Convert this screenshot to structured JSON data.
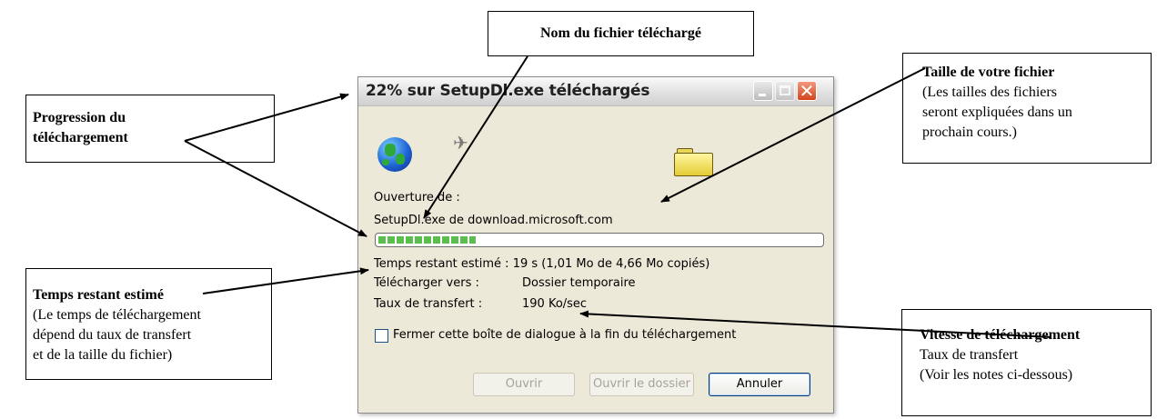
{
  "dialog": {
    "title": "22% sur SetupDl.exe téléchargés",
    "opening_label": "Ouverture de :",
    "source": "SetupDl.exe de download.microsoft.com",
    "progress": 0.22,
    "time_remaining": "Temps restant estimé : 19 s (1,01 Mo de 4,66 Mo copiés)",
    "download_to_label": "Télécharger vers :",
    "download_to_value": "Dossier temporaire",
    "rate_label": "Taux de transfert :",
    "rate_value": "190 Ko/sec",
    "checkbox_label": "Fermer cette boîte de dialogue à la fin du téléchargement",
    "checkbox_checked": false,
    "buttons": {
      "open": "Ouvrir",
      "open_folder": "Ouvrir le dossier",
      "cancel": "Annuler"
    },
    "window_buttons": {
      "close": "✕"
    },
    "icons": [
      "globe-icon",
      "paper-icon",
      "folder-icon"
    ]
  },
  "callouts": {
    "file_name": {
      "title": "Nom du fichier téléchargé"
    },
    "progress": {
      "title": "Progression du téléchargement"
    },
    "file_size": {
      "title": "Taille de votre fichier",
      "text": "(Les tailles des fichiers\nseront expliquées dans un\nprochain cours.)"
    },
    "time": {
      "title": "Temps restant estimé",
      "text": "(Le temps de téléchargement\ndépend du taux de transfert\net de la taille du fichier)"
    },
    "speed": {
      "title": "Vitesse de téléchargement",
      "text": "Taux de transfert\n(Voir les notes ci-dessous)"
    }
  }
}
